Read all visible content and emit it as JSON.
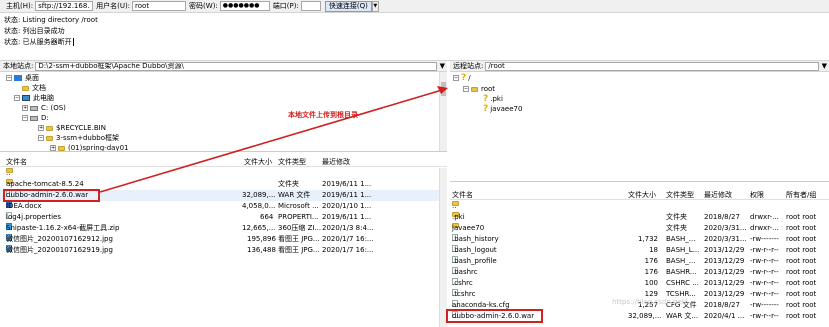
{
  "quickconnect": {
    "host_label": "主机(H):",
    "host_value": "sftp://192.168.",
    "user_label": "用户名(U):",
    "user_value": "root",
    "pass_label": "密码(W):",
    "pass_value": "●●●●●●●",
    "port_label": "端口(P):",
    "port_value": "",
    "connect_label": "快速连接(Q)"
  },
  "log": [
    {
      "prefix": "状态:",
      "text": "Listing directory /root"
    },
    {
      "prefix": "状态:",
      "text": "列出目录成功"
    },
    {
      "prefix": "状态:",
      "text": "已从服务器断开"
    }
  ],
  "local": {
    "site_label": "本地站点:",
    "site_path": "D:\\2-ssm+dubbo框架\\Apache Dubbo\\资源\\",
    "tree": [
      "桌面",
      "文档",
      "此电脑",
      "C: (OS)",
      "D:",
      "$RECYCLE.BIN",
      "3-ssm+dubbo框架",
      "(01)spring-day01"
    ],
    "headers": [
      "文件名",
      "文件大小",
      "文件类型",
      "最近修改"
    ],
    "files": [
      {
        "name": "..",
        "size": "",
        "type": "",
        "date": ""
      },
      {
        "name": "apache-tomcat-8.5.24",
        "size": "",
        "type": "文件夹",
        "date": "2019/6/11 1..."
      },
      {
        "name": "dubbo-admin-2.6.0.war",
        "size": "32,089,...",
        "type": "WAR 文件",
        "date": "2019/6/11 1..."
      },
      {
        "name": "IDEA.docx",
        "size": "4,058,0...",
        "type": "Microsoft ...",
        "date": "2020/1/10 1..."
      },
      {
        "name": "log4j.properties",
        "size": "664",
        "type": "PROPERTI...",
        "date": "2019/6/11 1..."
      },
      {
        "name": "Snipaste-1.16.2-x64-截屏工具.zip",
        "size": "12,665,...",
        "type": "360压缩 ZI...",
        "date": "2020/1/3 8:4..."
      },
      {
        "name": "微信图片_20200107162912.jpg",
        "size": "195,896",
        "type": "看图王 JPG...",
        "date": "2020/1/7 16:..."
      },
      {
        "name": "微信图片_20200107162919.jpg",
        "size": "136,488",
        "type": "看图王 JPG...",
        "date": "2020/1/7 16:..."
      }
    ]
  },
  "remote": {
    "site_label": "远程站点:",
    "site_path": "/root",
    "tree": [
      "/",
      "root",
      ".pki",
      "javaee70"
    ],
    "headers": [
      "文件名",
      "文件大小",
      "文件类型",
      "最近修改",
      "权限",
      "所有者/组"
    ],
    "files": [
      {
        "name": "..",
        "size": "",
        "type": "",
        "date": "",
        "perm": "",
        "owner": ""
      },
      {
        "name": ".pki",
        "size": "",
        "type": "文件夹",
        "date": "2018/8/27",
        "perm": "drwxr-...",
        "owner": "root root"
      },
      {
        "name": "javaee70",
        "size": "",
        "type": "文件夹",
        "date": "2020/3/31...",
        "perm": "drwxr-...",
        "owner": "root root"
      },
      {
        "name": ".bash_history",
        "size": "1,732",
        "type": "BASH_...",
        "date": "2020/3/31...",
        "perm": "-rw-------",
        "owner": "root root"
      },
      {
        "name": ".bash_logout",
        "size": "18",
        "type": "BASH_L...",
        "date": "2013/12/29",
        "perm": "-rw-r--r--",
        "owner": "root root"
      },
      {
        "name": ".bash_profile",
        "size": "176",
        "type": "BASH_...",
        "date": "2013/12/29",
        "perm": "-rw-r--r--",
        "owner": "root root"
      },
      {
        "name": ".bashrc",
        "size": "176",
        "type": "BASHR...",
        "date": "2013/12/29",
        "perm": "-rw-r--r--",
        "owner": "root root"
      },
      {
        "name": ".cshrc",
        "size": "100",
        "type": "CSHRC ...",
        "date": "2013/12/29",
        "perm": "-rw-r--r--",
        "owner": "root root"
      },
      {
        "name": ".tcshrc",
        "size": "129",
        "type": "TCSHR...",
        "date": "2013/12/29",
        "perm": "-rw-r--r--",
        "owner": "root root"
      },
      {
        "name": "anaconda-ks.cfg",
        "size": "1,257",
        "type": "CFG 文件",
        "date": "2018/8/27",
        "perm": "-rw-------",
        "owner": "root root"
      },
      {
        "name": "dubbo-admin-2.6.0.war",
        "size": "32,089,...",
        "type": "WAR 文...",
        "date": "2020/4/1 ...",
        "perm": "-rw-r--r--",
        "owner": "root root"
      }
    ]
  },
  "annotation": "本地文件上传到根目录",
  "watermark": "https://blog.csdn.net/...",
  "colors": {
    "highlight": "#d02020",
    "folder": "#e8c44a"
  }
}
